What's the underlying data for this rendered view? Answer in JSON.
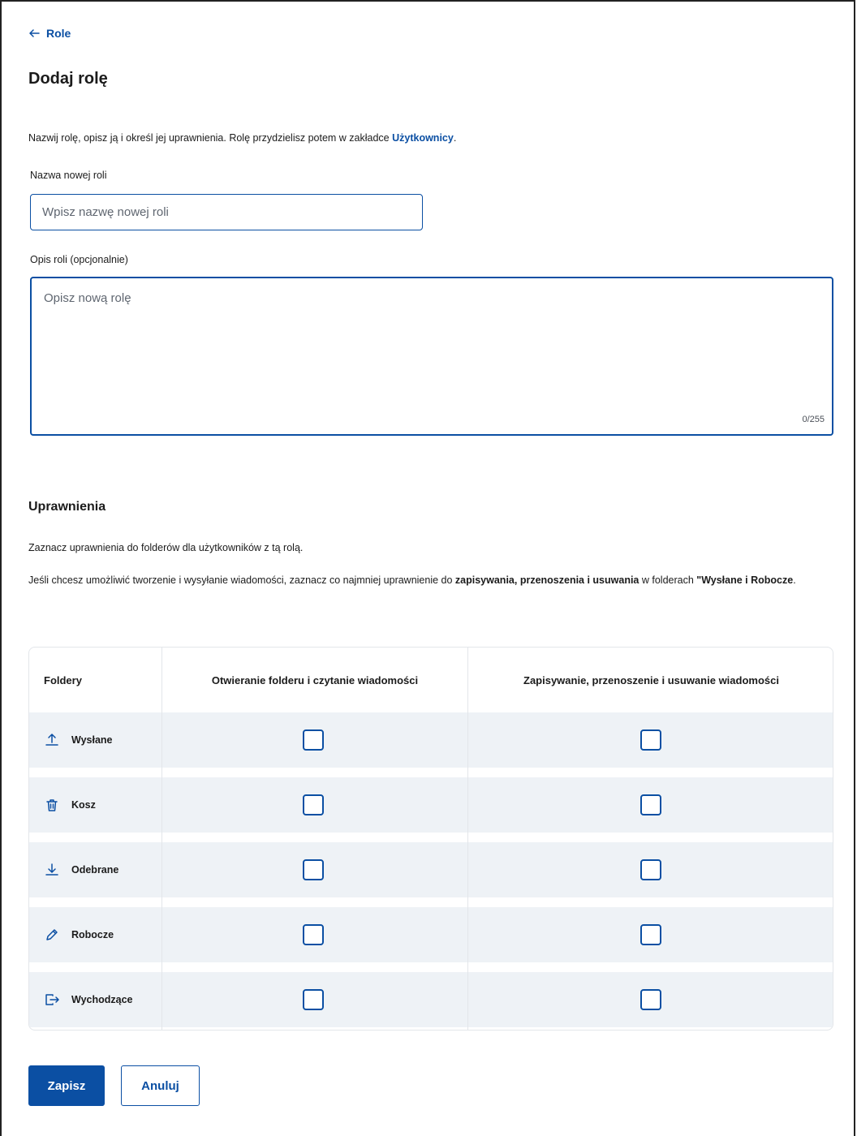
{
  "back_link": {
    "label": "Role"
  },
  "page_title": "Dodaj rolę",
  "intro": {
    "text": "Nazwij rolę, opisz ją i określ jej uprawnienia. Rolę przydzielisz potem w zakładce ",
    "link": "Użytkownicy",
    "suffix": "."
  },
  "role_name": {
    "label": "Nazwa nowej roli",
    "placeholder": "Wpisz nazwę nowej roli",
    "value": ""
  },
  "role_description": {
    "label": "Opis roli (opcjonalnie)",
    "placeholder": "Opisz nową rolę",
    "value": "",
    "counter": "0/255"
  },
  "permissions": {
    "heading": "Uprawnienia",
    "text1": "Zaznacz uprawnienia do folderów dla użytkowników z tą rolą.",
    "text2_pre": "Jeśli chcesz umożliwić tworzenie i wysyłanie wiadomości, zaznacz co najmniej uprawnienie do ",
    "text2_bold": "zapisywania, przenoszenia i usuwania",
    "text2_mid": " w folderach ",
    "text2_bold2": "\"Wysłane i Robocze",
    "text2_end": "."
  },
  "table": {
    "headers": [
      "Foldery",
      "Otwieranie folderu i czytanie wiadomości",
      "Zapisywanie, przenoszenie i usuwanie wiadomości"
    ],
    "rows": [
      {
        "label": "Wysłane",
        "icon": "upload-icon",
        "read": false,
        "write": false
      },
      {
        "label": "Kosz",
        "icon": "trash-icon",
        "read": false,
        "write": false
      },
      {
        "label": "Odebrane",
        "icon": "download-icon",
        "read": false,
        "write": false
      },
      {
        "label": "Robocze",
        "icon": "pencil-icon",
        "read": false,
        "write": false
      },
      {
        "label": "Wychodzące",
        "icon": "outbox-icon",
        "read": false,
        "write": false
      }
    ]
  },
  "actions": {
    "save": "Zapisz",
    "cancel": "Anuluj"
  },
  "colors": {
    "primary": "#0b4fa3",
    "row_bg": "#eef2f6"
  }
}
